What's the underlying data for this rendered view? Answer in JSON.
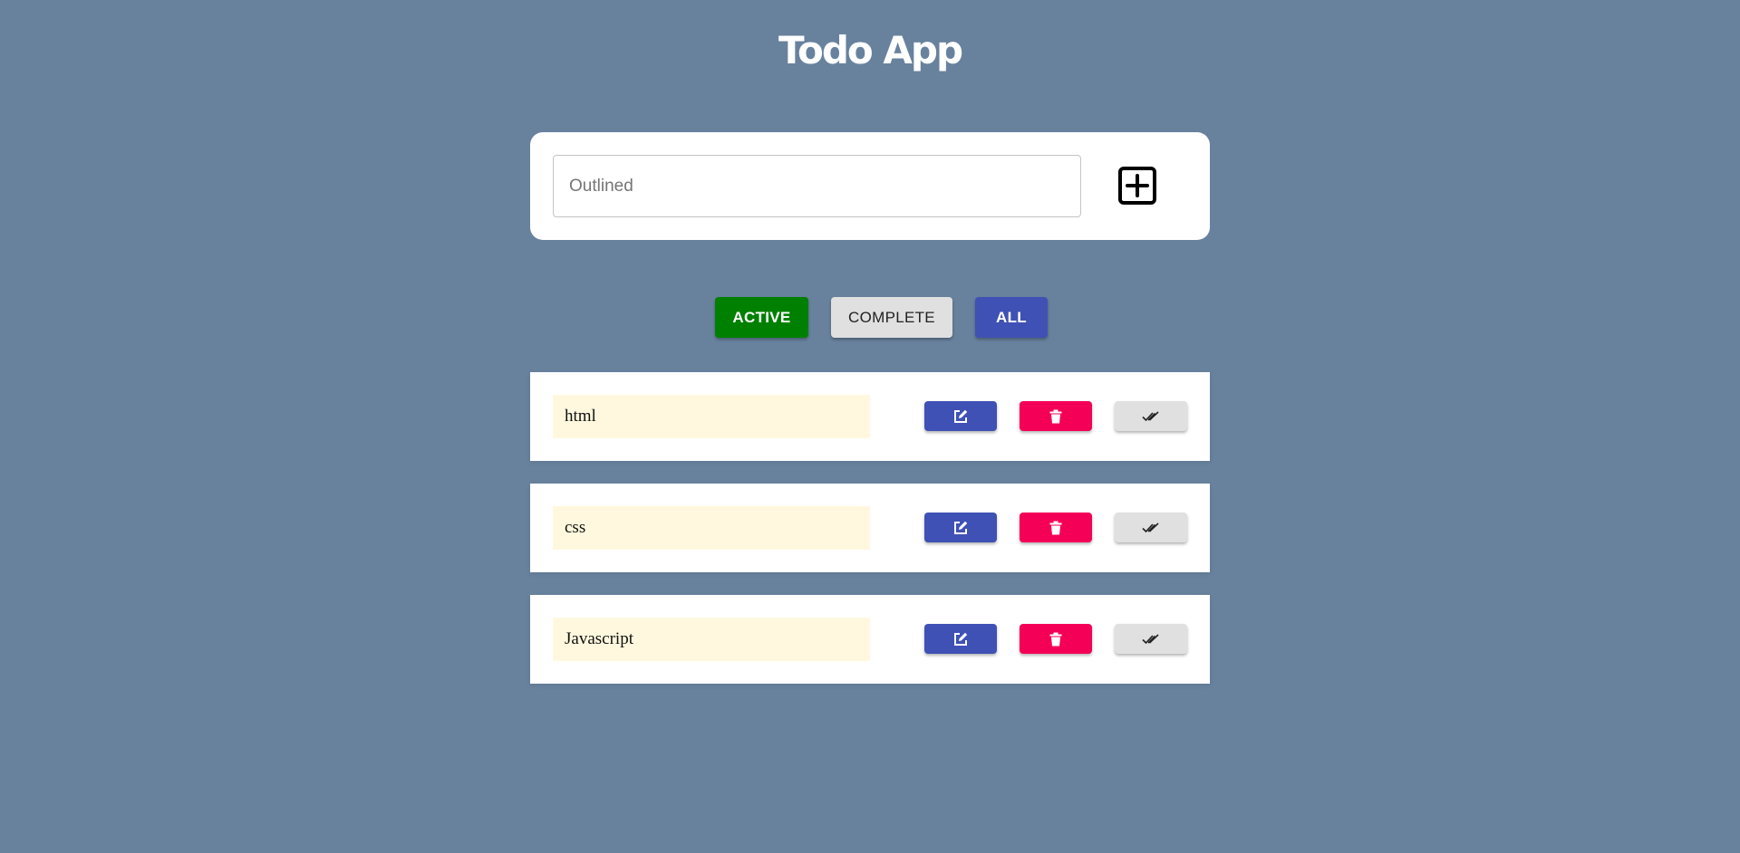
{
  "app": {
    "title": "Todo App"
  },
  "input": {
    "placeholder": "Outlined",
    "value": "",
    "add_icon": "plus-square-icon"
  },
  "filters": [
    {
      "label": "ACTIVE",
      "color": "#008000"
    },
    {
      "label": "COMPLETE",
      "color": "#e0e0e0"
    },
    {
      "label": "ALL",
      "color": "#3f51b5"
    }
  ],
  "todos": [
    {
      "text": "html"
    },
    {
      "text": "css"
    },
    {
      "text": "Javascript"
    }
  ],
  "item_actions": {
    "edit_icon": "edit-icon",
    "delete_icon": "trash-icon",
    "complete_icon": "double-check-icon"
  },
  "colors": {
    "background": "#68829e",
    "edit": "#3f51b5",
    "delete": "#f50057",
    "complete": "#e0e0e0",
    "todo_text_bg": "#fff8de"
  }
}
